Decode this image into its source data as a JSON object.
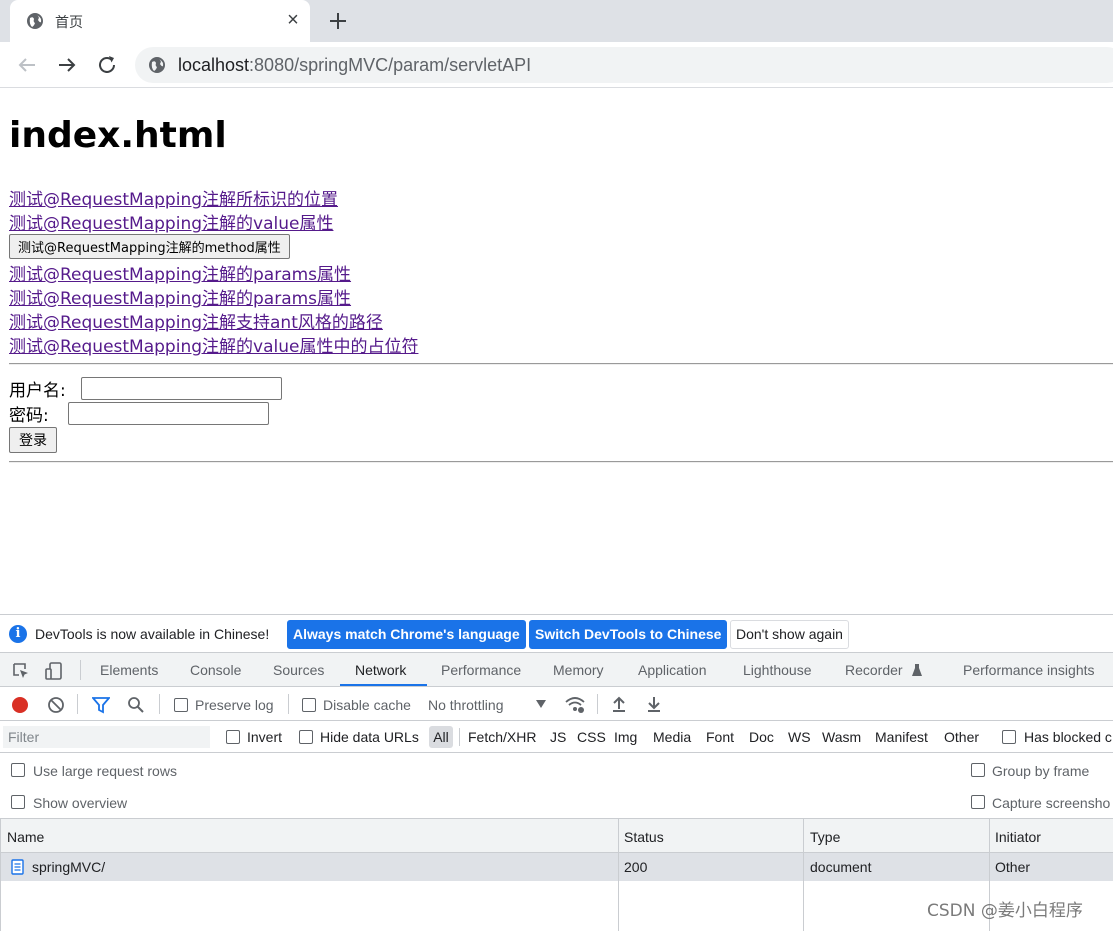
{
  "browser": {
    "tab_title": "首页",
    "tab_close": "×",
    "url_host": "localhost",
    "url_rest": ":8080/springMVC/param/servletAPI"
  },
  "page": {
    "title": "index.html",
    "links": [
      "测试@RequestMapping注解所标识的位置",
      "测试@RequestMapping注解的value属性",
      "测试@RequestMapping注解的params属性",
      "测试@RequestMapping注解的params属性",
      "测试@RequestMapping注解支持ant风格的路径",
      "测试@RequestMapping注解的value属性中的占位符"
    ],
    "method_button": "测试@RequestMapping注解的method属性",
    "form": {
      "username_label": "用户名:",
      "password_label": "密码:",
      "username_value": "",
      "password_value": "",
      "submit_label": "登录"
    }
  },
  "devtools": {
    "infobar": {
      "message": "DevTools is now available in Chinese!",
      "btn_match": "Always match Chrome's language",
      "btn_switch": "Switch DevTools to Chinese",
      "btn_dismiss": "Don't show again"
    },
    "tabs": [
      "Elements",
      "Console",
      "Sources",
      "Network",
      "Performance",
      "Memory",
      "Application",
      "Lighthouse",
      "Recorder",
      "Performance insights"
    ],
    "active_tab": "Network",
    "toolbar": {
      "preserve_log": "Preserve log",
      "disable_cache": "Disable cache",
      "throttling": "No throttling"
    },
    "filter": {
      "placeholder": "Filter",
      "invert": "Invert",
      "hide_data_urls": "Hide data URLs",
      "all": "All",
      "types": [
        "Fetch/XHR",
        "JS",
        "CSS",
        "Img",
        "Media",
        "Font",
        "Doc",
        "WS",
        "Wasm",
        "Manifest",
        "Other"
      ],
      "has_blocked": "Has blocked c"
    },
    "options": {
      "large_rows": "Use large request rows",
      "show_overview": "Show overview",
      "group_by_frame": "Group by frame",
      "capture_screenshots": "Capture screensho"
    },
    "grid": {
      "headers": [
        "Name",
        "Status",
        "Type",
        "Initiator"
      ],
      "rows": [
        {
          "name": "springMVC/",
          "status": "200",
          "type": "document",
          "initiator": "Other"
        }
      ]
    }
  },
  "watermark": "CSDN @姜小白程序",
  "colors": {
    "accent": "#1a73e8",
    "visited_link": "#551a8b",
    "record": "#d93025"
  }
}
